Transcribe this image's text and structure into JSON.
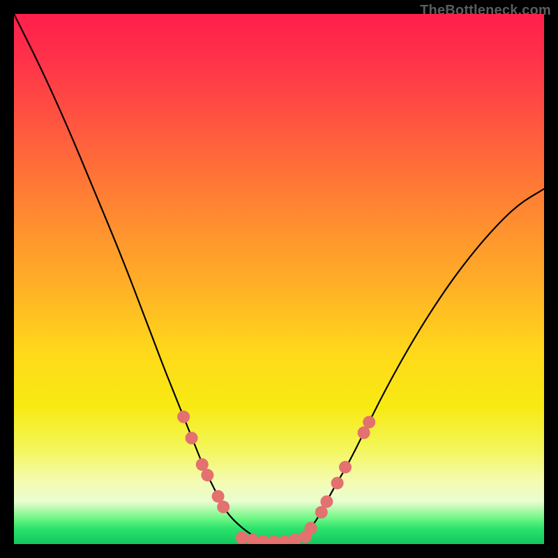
{
  "watermark": "TheBottleneck.com",
  "colors": {
    "background": "#000000",
    "dot_fill": "#e2716f",
    "curve_stroke": "#000000",
    "gradient_top": "#ff1f4b",
    "gradient_bottom": "#12c75e"
  },
  "chart_data": {
    "type": "line",
    "title": "",
    "xlabel": "",
    "ylabel": "",
    "xlim": [
      0,
      100
    ],
    "ylim": [
      0,
      100
    ],
    "curve": {
      "x": [
        0,
        5,
        10,
        15,
        20,
        25,
        28,
        30,
        32,
        34,
        36,
        38,
        40,
        43,
        46,
        50,
        54,
        56,
        58,
        60,
        63,
        66,
        70,
        75,
        80,
        85,
        90,
        95,
        100
      ],
      "y": [
        100,
        90,
        79,
        67,
        55,
        42,
        34,
        29,
        24,
        19,
        14,
        10,
        6,
        3,
        1,
        0,
        1,
        3,
        6,
        10,
        15,
        21,
        29,
        38,
        46,
        53,
        59,
        64,
        67
      ]
    },
    "series": [
      {
        "name": "left-cluster-dots",
        "type": "scatter",
        "points": [
          {
            "x": 32,
            "y": 24
          },
          {
            "x": 33.5,
            "y": 20
          },
          {
            "x": 35.5,
            "y": 15
          },
          {
            "x": 36.5,
            "y": 13
          },
          {
            "x": 38.5,
            "y": 9
          },
          {
            "x": 39.5,
            "y": 7
          }
        ]
      },
      {
        "name": "right-cluster-dots",
        "type": "scatter",
        "points": [
          {
            "x": 56,
            "y": 3
          },
          {
            "x": 58,
            "y": 6
          },
          {
            "x": 59,
            "y": 8
          },
          {
            "x": 61,
            "y": 11.5
          },
          {
            "x": 62.5,
            "y": 14.5
          },
          {
            "x": 66,
            "y": 21
          },
          {
            "x": 67,
            "y": 23
          }
        ]
      },
      {
        "name": "bottom-flat-dots",
        "type": "scatter",
        "points": [
          {
            "x": 43,
            "y": 1.2
          },
          {
            "x": 45,
            "y": 0.8
          },
          {
            "x": 47,
            "y": 0.5
          },
          {
            "x": 49,
            "y": 0.4
          },
          {
            "x": 51,
            "y": 0.5
          },
          {
            "x": 53,
            "y": 0.8
          },
          {
            "x": 55,
            "y": 1.4
          }
        ]
      }
    ],
    "gradient_bands_note": "background vertical gradient from red (high y) through orange, yellow, pale yellow, to green (low y)"
  }
}
